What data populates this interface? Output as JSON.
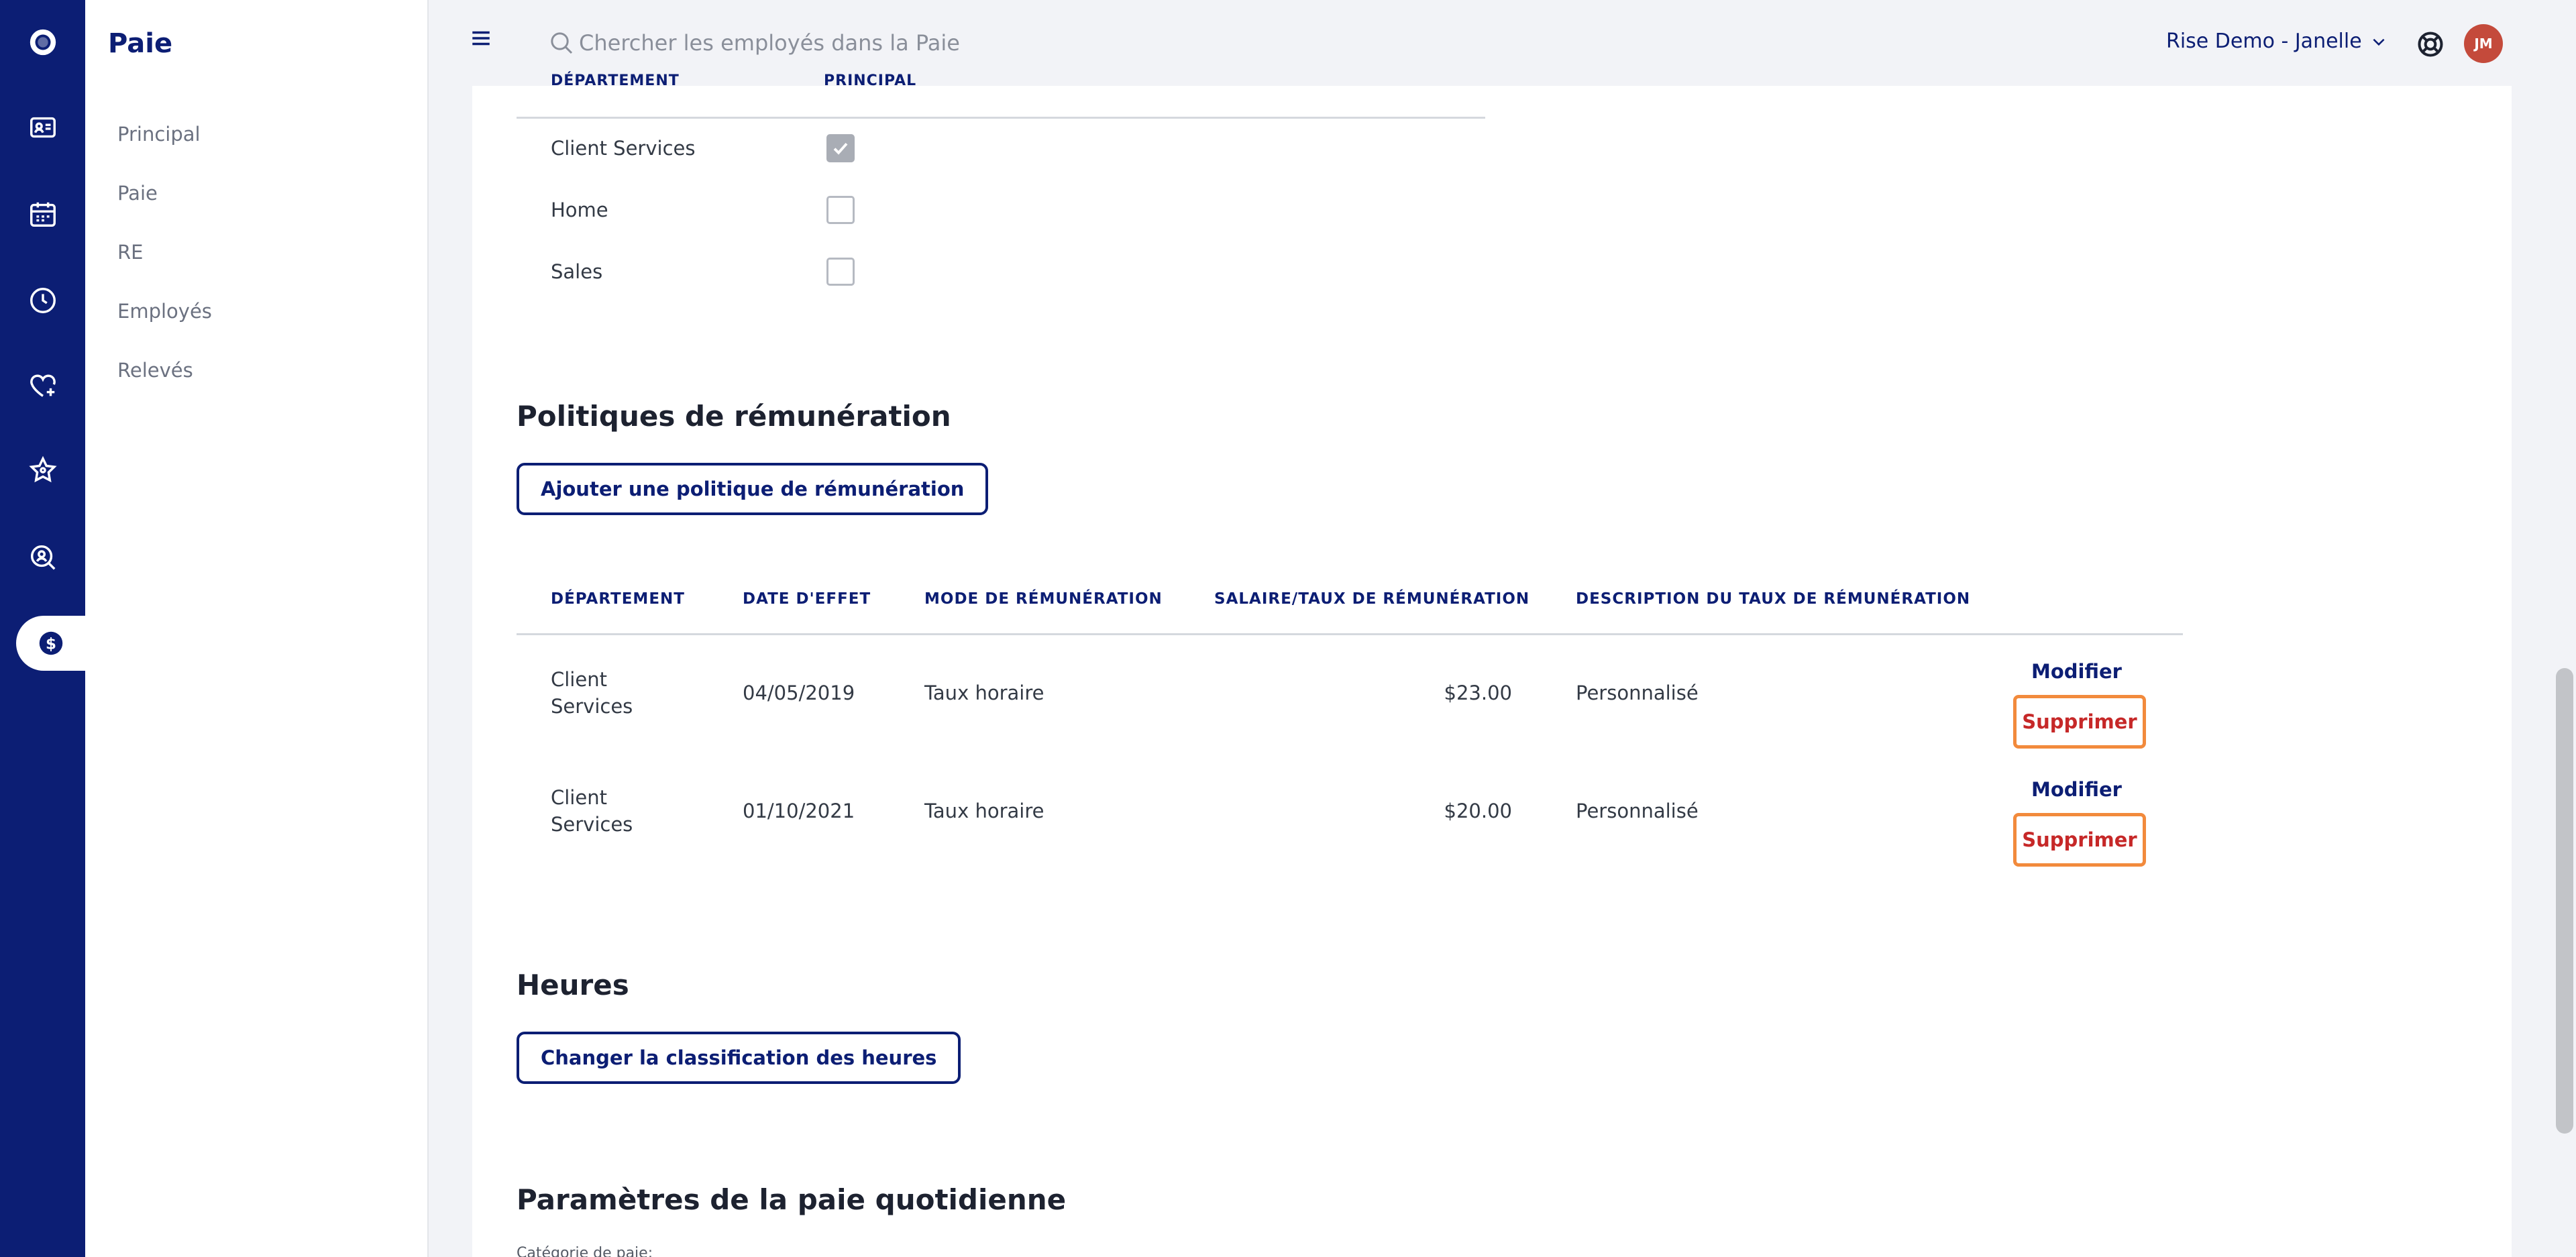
{
  "sidebar": {
    "title": "Paie",
    "items": [
      {
        "label": "Principal"
      },
      {
        "label": "Paie"
      },
      {
        "label": "RE"
      },
      {
        "label": "Employés"
      },
      {
        "label": "Relevés"
      }
    ]
  },
  "rail": {
    "icons": [
      "logo-icon",
      "id-card-icon",
      "calendar-icon",
      "clock-icon",
      "heart-plus-icon",
      "star-icon",
      "search-person-icon",
      "dollar-icon"
    ],
    "active": "dollar-icon"
  },
  "topbar": {
    "search_placeholder": "Chercher les employés dans la Paie",
    "account_name": "Rise Demo - Janelle",
    "avatar_initials": "JM"
  },
  "departments": {
    "header_department": "DÉPARTEMENT",
    "header_primary": "PRINCIPAL",
    "rows": [
      {
        "name": "Client Services",
        "primary": true
      },
      {
        "name": "Home",
        "primary": false
      },
      {
        "name": "Sales",
        "primary": false
      }
    ]
  },
  "pay_policies": {
    "title": "Politiques de rémunération",
    "add_button": "Ajouter une politique de rémunération",
    "columns": [
      "DÉPARTEMENT",
      "DATE D'EFFET",
      "MODE DE RÉMUNÉRATION",
      "SALAIRE/TAUX DE RÉMUNÉRATION",
      "DESCRIPTION DU TAUX DE RÉMUNÉRATION"
    ],
    "rows": [
      {
        "department_line1": "Client",
        "department_line2": "Services",
        "effective_date": "04/05/2019",
        "mode": "Taux horaire",
        "rate": "$23.00",
        "description": "Personnalisé",
        "edit_label": "Modifier",
        "delete_label": "Supprimer"
      },
      {
        "department_line1": "Client",
        "department_line2": "Services",
        "effective_date": "01/10/2021",
        "mode": "Taux horaire",
        "rate": "$20.00",
        "description": "Personnalisé",
        "edit_label": "Modifier",
        "delete_label": "Supprimer"
      }
    ]
  },
  "hours": {
    "title": "Heures",
    "change_button": "Changer la classification des heures"
  },
  "daily_pay": {
    "title": "Paramètres de la paie quotidienne",
    "category_label": "Catégorie de paie:"
  },
  "colors": {
    "brand": "#0c1e74",
    "delete_text": "#c62828",
    "highlight_border": "#f28a3c",
    "avatar": "#c44a3b"
  }
}
